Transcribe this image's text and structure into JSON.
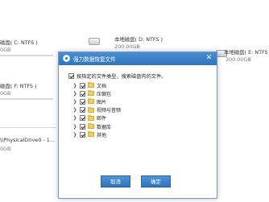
{
  "background": {
    "drives": [
      {
        "name": "磁盘( C: NTFS )",
        "size": "0GB"
      },
      {
        "name": "本地磁盘( D: NTFS )",
        "size": "200.00GB"
      },
      {
        "name": "本地磁盘( E: NTFS",
        "size": "300.00GB"
      },
      {
        "name": "磁盘( F: NTFS )",
        "size": "0GB"
      }
    ],
    "physical_drive": {
      "name": "\\\\PhysicalDrive0 - 1...",
      "size": "0GB"
    }
  },
  "dialog": {
    "title": "强力数据恢复文件",
    "close_glyph": "✕",
    "root_checkbox_label": "按指定的文件类型，搜索磁盘内的文件。",
    "file_types": [
      {
        "label": "文档",
        "checked": true
      },
      {
        "label": "压缩包",
        "checked": true
      },
      {
        "label": "图片",
        "checked": true
      },
      {
        "label": "视频与音频",
        "checked": true
      },
      {
        "label": "邮件",
        "checked": true
      },
      {
        "label": "数据库",
        "checked": true
      },
      {
        "label": "其他",
        "checked": true
      }
    ],
    "expander_glyph": "❯",
    "cancel_label": "取消",
    "ok_label": "确定"
  },
  "colors": {
    "titlebar": "#3a80c6",
    "button": "#3a80c6",
    "folder": "#f2cd62"
  }
}
